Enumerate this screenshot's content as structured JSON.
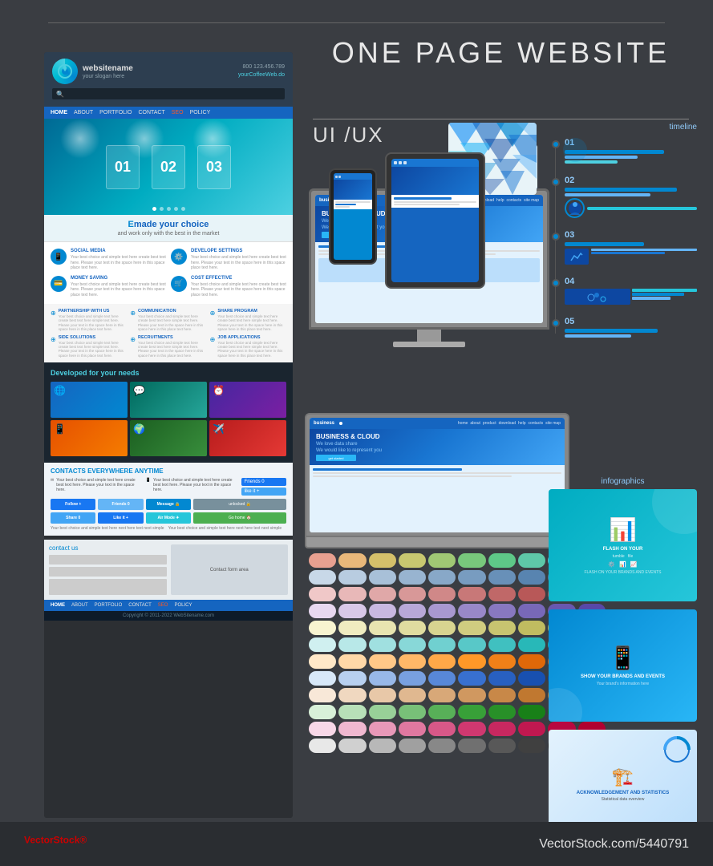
{
  "title": "ONE PAGE WEBSITE",
  "site": {
    "logo_name": "websitename",
    "logo_slogan": "your slogan here",
    "phone": "800 123.456.789",
    "email": "yourCoffeeWeb.do",
    "nav_items": [
      {
        "label": "HOME",
        "active": true
      },
      {
        "label": "ABOUT"
      },
      {
        "label": "PORTFOLIO"
      },
      {
        "label": "CONTACT"
      },
      {
        "label": "SEO",
        "highlight": true
      },
      {
        "label": "POLICY"
      }
    ],
    "hero_slides": [
      "01",
      "02",
      "03"
    ],
    "feature_main": "made your choice",
    "feature_sub": "and work only with the best in the market",
    "features": [
      {
        "title": "SOCIAL MEDIA",
        "icon": "📱"
      },
      {
        "title": "DEVELOPE SETTINGS",
        "icon": "⚙️"
      },
      {
        "title": "MONEY SAVING",
        "icon": "💳"
      },
      {
        "title": "COST EFFECTIVE",
        "icon": "🛒"
      }
    ],
    "services": [
      {
        "title": "PARTNERSHIP WITH US"
      },
      {
        "title": "COMMUNICATION"
      },
      {
        "title": "SHARE PROGRAM"
      },
      {
        "title": "SIDE SOLUTIONS"
      },
      {
        "title": "RECRUITMENTS"
      },
      {
        "title": "JOB APPLICATIONS"
      }
    ],
    "portfolio_title": "Developed for your needs",
    "contact_title": "CONTACTS EVERYWHERE ANYTIME",
    "social_buttons": [
      "Follow +",
      "Friends 0",
      "Message 🔒",
      "unlocked 🔓",
      "Share 0",
      "Like it +",
      "Air Mode ✈",
      "Go home 🏠"
    ],
    "contact_form_title": "contact us",
    "copyright": "Copyright © 2011-2022  WebSitename.com",
    "footer_nav": [
      "HOME",
      "ABOUT",
      "PORTFOLIO",
      "CONTACT",
      "SEO",
      "POLICY"
    ]
  },
  "right_panel": {
    "uiux_label": "UI /UX",
    "timeline_label": "timeline",
    "infographics_label": "infographics",
    "timeline_items": [
      {
        "num": "01"
      },
      {
        "num": "02"
      },
      {
        "num": "03"
      },
      {
        "num": "04"
      },
      {
        "num": "05"
      }
    ],
    "info_boxes": [
      {
        "caption": ""
      },
      {
        "caption": "FLASH ON YOUR BRANDS AND EVENTS"
      },
      {
        "caption": "ACKNOWLEDGEMENT AND STATISTICS"
      }
    ],
    "business_screen": {
      "logo": "business",
      "nav": [
        "home",
        "about",
        "product",
        "download",
        "help",
        "contacts",
        "site map"
      ],
      "title": "BUSINESS & CLOUD",
      "subtitle1": "We love data share",
      "subtitle2": "We would like to represent you",
      "cta": "get started"
    }
  },
  "watermark": {
    "left": "VectorStock",
    "left_reg": "®",
    "right": "VectorStock.com/5440791"
  },
  "palette_rows": [
    [
      "#e8a090",
      "#e8b87a",
      "#d4b86e",
      "#c8c870",
      "#a0c874",
      "#78c87c",
      "#5ec88a",
      "#5ec8a8",
      "#5ec8c4",
      "#5ac8d8",
      "#4ab0d8",
      "#4490c8",
      "#5078b8",
      "#6068a8",
      "#7060a0",
      "#845898",
      "#905090",
      "#904878",
      "#904060",
      "#904048"
    ],
    [
      "#c8d8e8",
      "#b8cce0",
      "#a8c0d8",
      "#98b4d0",
      "#88a8c8",
      "#789cc0",
      "#6890b8",
      "#5884b0",
      "#4878a8",
      "#386ca0",
      "#286098",
      "#185490",
      "#0c4888",
      "#083c80",
      "#083078",
      "#042870",
      "#041c68",
      "#041060",
      "#040858",
      "#040050"
    ],
    [
      "#f0e8e0",
      "#e8dcd0",
      "#e0d0c0",
      "#d8c4b0",
      "#d0b8a0",
      "#c8ac90",
      "#c0a080",
      "#b89470",
      "#b08860",
      "#a87c50",
      "#a07040",
      "#986430",
      "#905820",
      "#884c10",
      "#804010",
      "#783408",
      "#702804",
      "#681c00",
      "#601000",
      "#580800"
    ],
    [
      "#e8f0e8",
      "#d8e8d8",
      "#c8e0c8",
      "#b8d8b8",
      "#a8d0a8",
      "#98c898",
      "#88c088",
      "#78b878",
      "#68b068",
      "#58a858",
      "#48a048",
      "#389838",
      "#289028",
      "#188818",
      "#088010",
      "#047808",
      "#047008",
      "#046800",
      "#046000",
      "#045800"
    ],
    [
      "#f0e8f0",
      "#e8d8e8",
      "#e0c8e0",
      "#d8b8d8",
      "#d0a8d0",
      "#c898c8",
      "#c088c0",
      "#b878b8",
      "#b068b0",
      "#a858a8",
      "#a048a0",
      "#983898",
      "#902890",
      "#881888",
      "#800880",
      "#780078",
      "#700070",
      "#680068",
      "#600060",
      "#580058"
    ],
    [
      "#fffff0",
      "#f8f8d8",
      "#f0f0c0",
      "#e8e8a8",
      "#e0e090",
      "#d8d878",
      "#d0d060",
      "#c8c848",
      "#c0c030",
      "#b8b818",
      "#b0b000",
      "#a8a800",
      "#a0a000",
      "#989800",
      "#909000",
      "#888800",
      "#808000",
      "#787800",
      "#707000",
      "#686800"
    ],
    [
      "#e0f0f8",
      "#c8e4f4",
      "#b0d8f0",
      "#98ccec",
      "#80c0e8",
      "#68b4e4",
      "#50a8e0",
      "#389cdc",
      "#2090d8",
      "#0884d4",
      "#0078d0",
      "#006ccc",
      "#0060c8",
      "#0054c4",
      "#0048c0",
      "#003cbc",
      "#0030b8",
      "#0024b4",
      "#0018b0",
      "#000cac"
    ],
    [
      "#fce4ec",
      "#f8bbd0",
      "#f48fb1",
      "#f06292",
      "#ec407a",
      "#e91e63",
      "#d81b60",
      "#c2185b",
      "#ad1457",
      "#880e4f",
      "#7b0044",
      "#6a003c",
      "#590034",
      "#48002c",
      "#380024",
      "#27001c",
      "#160014",
      "#05000c",
      "#000004",
      "#000000"
    ]
  ],
  "more_palette_rows": [
    [
      "#ffe0b2",
      "#ffcc80",
      "#ffb74d",
      "#ffa726",
      "#ff9800",
      "#fb8c00",
      "#f57c00",
      "#ef6c00",
      "#e65100",
      "#bf360c",
      "#a52714",
      "#8d1c0c",
      "#741204",
      "#5b0800",
      "#410000",
      "#280000",
      "#0f0000",
      "#000000",
      "#000000",
      "#000000"
    ],
    [
      "#e8eaf6",
      "#c5cae9",
      "#9fa8da",
      "#7986cb",
      "#5c6bc0",
      "#3f51b5",
      "#3949ab",
      "#303f9f",
      "#283593",
      "#1a237e",
      "#151c6e",
      "#10155e",
      "#0b0e4e",
      "#06073e",
      "#01002e",
      "#00001e",
      "#00000e",
      "#000000",
      "#000000",
      "#000000"
    ]
  ]
}
